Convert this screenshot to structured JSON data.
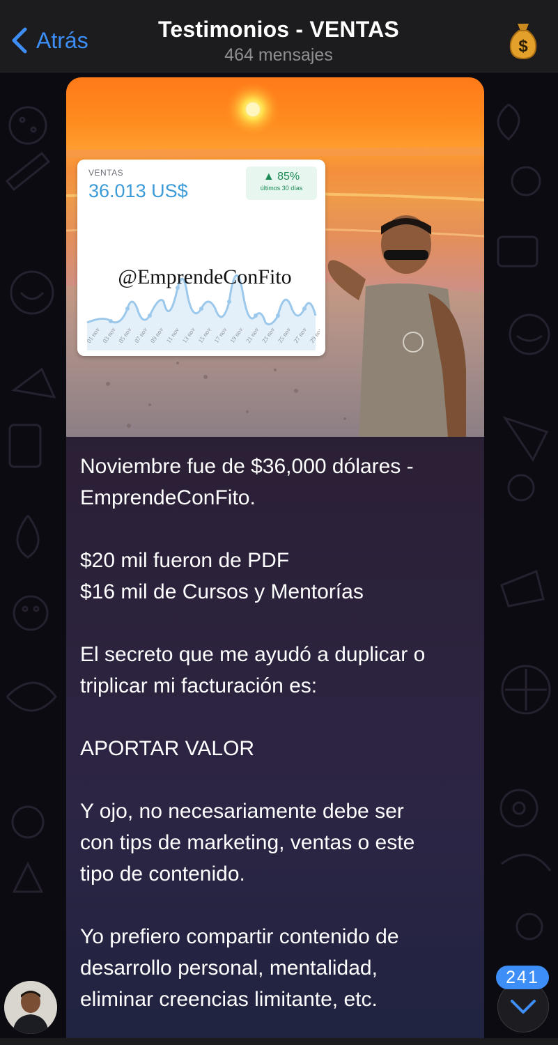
{
  "header": {
    "back_label": "Atrás",
    "title": "Testimonios - VENTAS",
    "subtitle": "464 mensajes",
    "channel_avatar_icon": "money-bag-icon",
    "accent_color": "#3e8ef7"
  },
  "message": {
    "image": {
      "card": {
        "label": "VENTAS",
        "value": "36.013 US$",
        "badge_percent": "85%",
        "badge_sub": "últimos 30 días",
        "watermark": "@EmprendeConFito",
        "x_ticks": [
          "01 nov",
          "03 nov",
          "05 nov",
          "07 nov",
          "09 nov",
          "11 nov",
          "13 nov",
          "15 nov",
          "17 nov",
          "19 nov",
          "21 nov",
          "23 nov",
          "25 nov",
          "27 nov",
          "29 nov"
        ]
      }
    },
    "paragraphs": [
      [
        "Noviembre fue de $36,000 dólares -",
        "EmprendeConFito."
      ],
      [
        "$20 mil fueron de PDF",
        "$16 mil de Cursos y Mentorías"
      ],
      [
        "El secreto que me ayudó a duplicar o",
        "triplicar mi facturación es:"
      ],
      [
        "APORTAR VALOR"
      ],
      [
        "Y ojo, no necesariamente debe ser",
        "con tips de marketing, ventas o este",
        "tipo de contenido."
      ],
      [
        "Yo prefiero compartir contenido de",
        "desarrollo personal, mentalidad,",
        "eliminar creencias limitante, etc."
      ]
    ]
  },
  "scroll": {
    "unread_count": "241",
    "icon": "chevron-down-icon"
  }
}
